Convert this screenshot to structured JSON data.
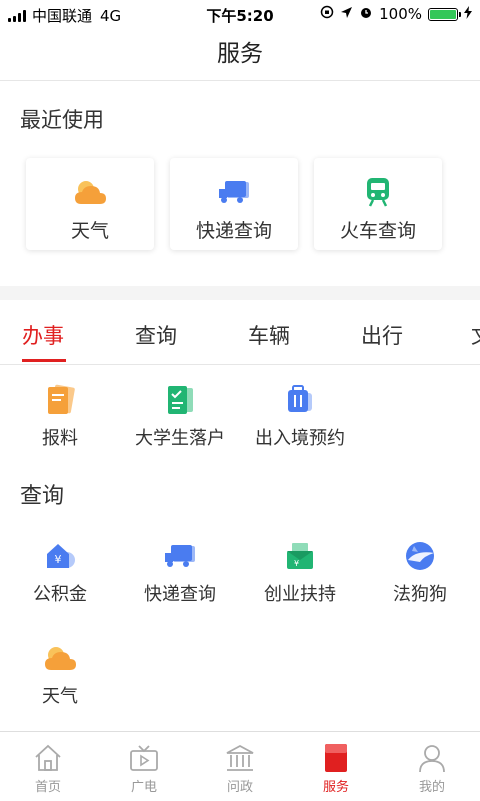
{
  "status_bar": {
    "carrier": "中国联通",
    "network": "4G",
    "time": "下午5:20",
    "battery": "100%",
    "battery_level": 1.0
  },
  "page": {
    "title": "服务"
  },
  "recent": {
    "title": "最近使用",
    "items": [
      {
        "label": "天气",
        "icon": "weather-icon"
      },
      {
        "label": "快递查询",
        "icon": "truck-icon"
      },
      {
        "label": "火车查询",
        "icon": "train-icon"
      }
    ]
  },
  "tabs": {
    "items": [
      {
        "label": "办事",
        "active": true
      },
      {
        "label": "查询",
        "active": false
      },
      {
        "label": "车辆",
        "active": false
      },
      {
        "label": "出行",
        "active": false
      },
      {
        "label": "文",
        "active": false
      }
    ]
  },
  "banshi": {
    "items": [
      {
        "label": "报料",
        "icon": "report-icon"
      },
      {
        "label": "大学生落户",
        "icon": "checklist-icon"
      },
      {
        "label": "出入境预约",
        "icon": "luggage-icon"
      }
    ]
  },
  "chaxun": {
    "title": "查询",
    "items": [
      {
        "label": "公积金",
        "icon": "housing-fund-icon"
      },
      {
        "label": "快递查询",
        "icon": "truck-icon"
      },
      {
        "label": "创业扶持",
        "icon": "money-envelope-icon"
      },
      {
        "label": "法狗狗",
        "icon": "dog-icon"
      },
      {
        "label": "天气",
        "icon": "weather-icon"
      }
    ]
  },
  "bottom_nav": {
    "items": [
      {
        "label": "首页",
        "icon": "home-icon",
        "active": false
      },
      {
        "label": "广电",
        "icon": "tv-icon",
        "active": false
      },
      {
        "label": "问政",
        "icon": "government-icon",
        "active": false
      },
      {
        "label": "服务",
        "icon": "service-icon",
        "active": true
      },
      {
        "label": "我的",
        "icon": "profile-icon",
        "active": false
      }
    ]
  },
  "colors": {
    "accent": "#e02020",
    "orange": "#f5a03a",
    "blue": "#4a7cf0",
    "green": "#21b573"
  }
}
